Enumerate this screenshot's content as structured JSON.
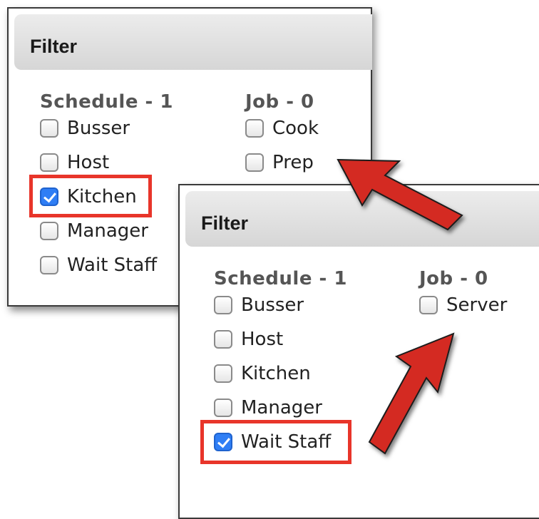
{
  "panel_top": {
    "title": "Filter",
    "schedule_header": "Schedule - 1",
    "job_header": "Job - 0",
    "schedule_options": [
      {
        "label": "Busser",
        "checked": false
      },
      {
        "label": "Host",
        "checked": false
      },
      {
        "label": "Kitchen",
        "checked": true
      },
      {
        "label": "Manager",
        "checked": false
      },
      {
        "label": "Wait Staff",
        "checked": false
      }
    ],
    "job_options": [
      {
        "label": "Cook",
        "checked": false
      },
      {
        "label": "Prep",
        "checked": false
      }
    ]
  },
  "panel_bottom": {
    "title": "Filter",
    "schedule_header": "Schedule - 1",
    "job_header": "Job - 0",
    "schedule_options": [
      {
        "label": "Busser",
        "checked": false
      },
      {
        "label": "Host",
        "checked": false
      },
      {
        "label": "Kitchen",
        "checked": false
      },
      {
        "label": "Manager",
        "checked": false
      },
      {
        "label": "Wait Staff",
        "checked": true
      }
    ],
    "job_options": [
      {
        "label": "Server",
        "checked": false
      }
    ]
  },
  "colors": {
    "highlight": "#e8352a",
    "arrow": "#d42b21",
    "checkbox_checked": "#2f7ef5"
  }
}
